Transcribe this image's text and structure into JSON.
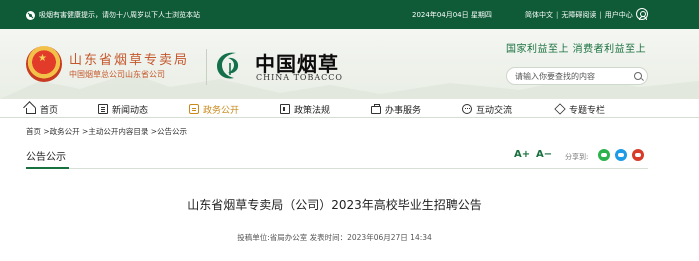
{
  "topbar": {
    "notice": "吸烟有害健康提示，请勿十八周岁以下人士浏览本站",
    "date": "2024年04月04日 星期四",
    "links": [
      "简体中文",
      "无障碍阅读",
      "用户中心"
    ],
    "separator": "|"
  },
  "brand": {
    "org_line1": "山东省烟草专卖局",
    "org_line2": "中国烟草总公司山东省公司",
    "cn_name": "中国烟草",
    "en_name": "CHINA TOBACCO",
    "slogan": "国家利益至上 消费者利益至上"
  },
  "search": {
    "placeholder": "请输入你要查找的内容"
  },
  "nav": {
    "items": [
      {
        "label": "首页",
        "icon": "home-icon"
      },
      {
        "label": "新闻动态",
        "icon": "news-icon"
      },
      {
        "label": "政务公开",
        "icon": "gov-open-icon",
        "active": true
      },
      {
        "label": "政策法规",
        "icon": "policy-icon"
      },
      {
        "label": "办事服务",
        "icon": "service-icon"
      },
      {
        "label": "互动交流",
        "icon": "chat-icon"
      },
      {
        "label": "专题专栏",
        "icon": "topic-icon"
      }
    ]
  },
  "breadcrumb": "首页 >政务公开 >主动公开内容目录 >公告公示",
  "section": {
    "title": "公告公示",
    "font_plus": "A+",
    "font_minus": "A−",
    "share_label": "分享到:"
  },
  "article": {
    "title": "山东省烟草专卖局（公司）2023年高校毕业生招聘公告",
    "meta": "投稿单位:省局办公室 发表时间：2023年06月27日 14:34"
  },
  "colors": {
    "brand_green": "#0f5b37",
    "accent_orange": "#c98a1c",
    "org_red": "#c4572b"
  }
}
